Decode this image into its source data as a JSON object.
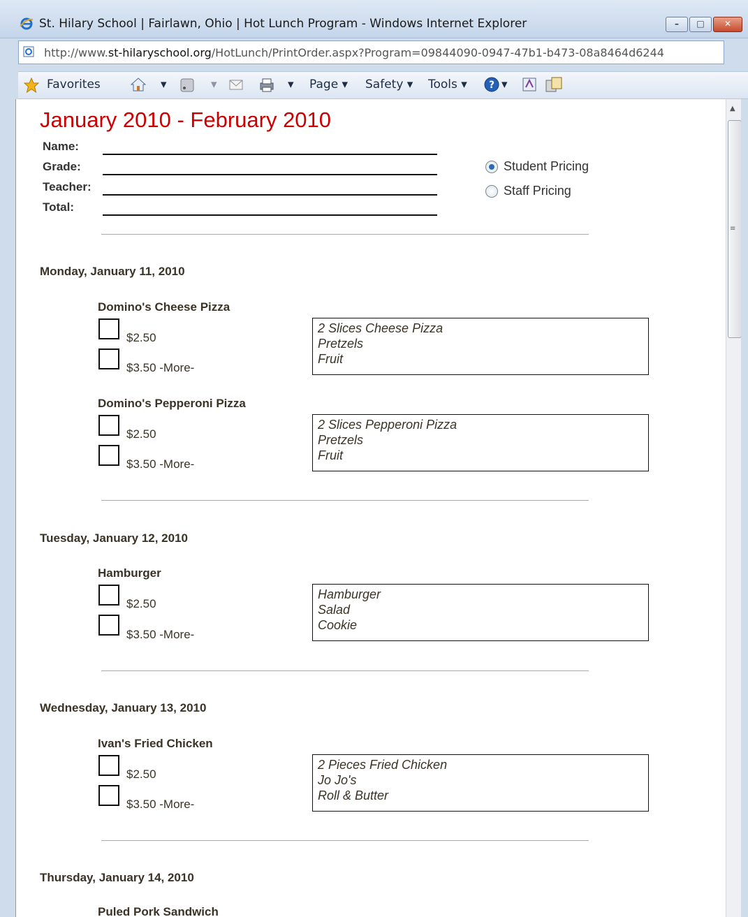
{
  "window": {
    "title": "St. Hilary School | Fairlawn, Ohio | Hot Lunch Program - Windows Internet Explorer",
    "minimize_glyph": "–",
    "maximize_glyph": "□",
    "close_glyph": "✕"
  },
  "address": {
    "url_prefix": "http://www.",
    "url_domain": "st-hilaryschool.org",
    "url_rest": "/HotLunch/PrintOrder.aspx?Program=09844090-0947-47b1-b473-08a8464d6244"
  },
  "commandbar": {
    "favorites": "Favorites",
    "page": "Page ▾",
    "safety": "Safety ▾",
    "tools": "Tools ▾",
    "dropdown_glyph": "▾"
  },
  "form": {
    "title": "January 2010 - February 2010",
    "name_label": "Name:",
    "grade_label": "Grade:",
    "teacher_label": "Teacher:",
    "total_label": "Total:",
    "student_pricing": "Student Pricing",
    "staff_pricing": "Staff Pricing",
    "selected_pricing": "Student Pricing"
  },
  "days": [
    {
      "date": "Monday, January 11, 2010",
      "items": [
        {
          "name": "Domino's Cheese Pizza",
          "price1": "$2.50",
          "price2": "$3.50 -More-",
          "desc": [
            "2 Slices Cheese Pizza",
            "Pretzels",
            "Fruit"
          ]
        },
        {
          "name": "Domino's Pepperoni Pizza",
          "price1": "$2.50",
          "price2": "$3.50 -More-",
          "desc": [
            "2 Slices Pepperoni Pizza",
            "Pretzels",
            "Fruit"
          ]
        }
      ]
    },
    {
      "date": "Tuesday, January 12, 2010",
      "items": [
        {
          "name": "Hamburger",
          "price1": "$2.50",
          "price2": "$3.50 -More-",
          "desc": [
            "Hamburger",
            "Salad",
            "Cookie"
          ]
        }
      ]
    },
    {
      "date": "Wednesday, January 13, 2010",
      "items": [
        {
          "name": "Ivan's Fried Chicken",
          "price1": "$2.50",
          "price2": "$3.50 -More-",
          "desc": [
            "2 Pieces Fried Chicken",
            "Jo Jo's",
            "Roll & Butter"
          ]
        }
      ]
    },
    {
      "date": "Thursday, January 14, 2010",
      "items": [
        {
          "name": "Puled Pork Sandwich"
        }
      ]
    }
  ]
}
